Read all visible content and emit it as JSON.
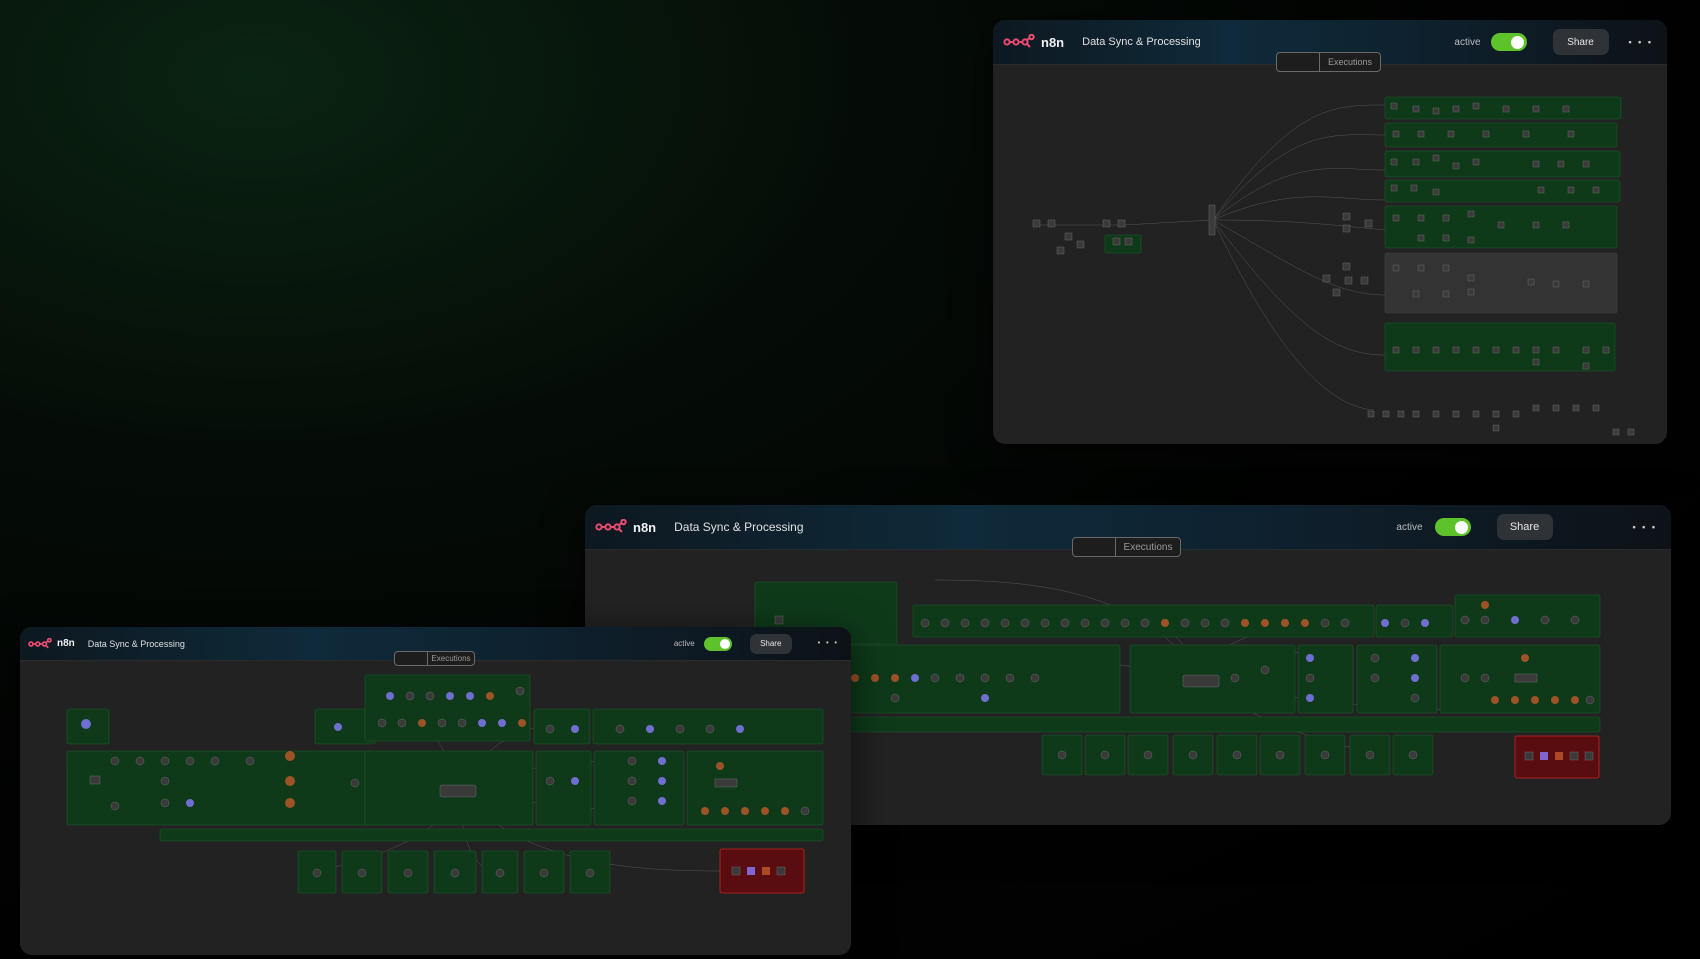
{
  "app": {
    "brand": "n8n",
    "workflow_title": "Data Sync & Processing",
    "active_label": "active",
    "share_label": "Share",
    "more_label": "• • •",
    "tabs": {
      "executions_label": "Executions"
    },
    "workflow_active": true
  },
  "icons": {
    "logo": "n8n-logo-icon",
    "more": "more-dots-icon"
  },
  "colors": {
    "accent_green": "#5ec22a",
    "group_green": "#0e3a1a",
    "group_red": "#5a0d10",
    "logo_pink": "#ea4b71",
    "canvas_bg": "#222222"
  }
}
